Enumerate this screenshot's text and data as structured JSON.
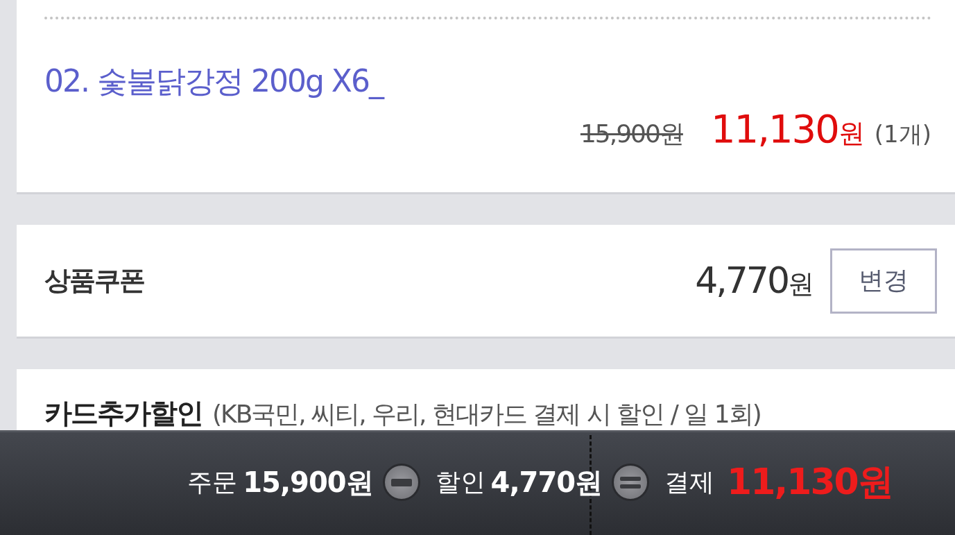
{
  "product": {
    "name": "02. 숯불닭강정 200g X6_",
    "original_price": "15,900원",
    "sale_amount": "11,130",
    "sale_unit": "원",
    "quantity": "(1개)"
  },
  "coupon": {
    "label": "상품쿠폰",
    "amount": "4,770",
    "unit": "원",
    "button": "변경"
  },
  "card_discount": {
    "label": "카드추가할인",
    "note": "(KB국민, 씨티, 우리, 현대카드 결제 시 할인 / 일 1회)"
  },
  "summary_bar": {
    "items": [
      {
        "kind": "amount",
        "label": "주문",
        "value": "15,900원"
      },
      {
        "kind": "minus"
      },
      {
        "kind": "amount",
        "label": "할인",
        "value": "4,770원"
      },
      {
        "kind": "equals"
      },
      {
        "kind": "total",
        "label": "결제",
        "value": "11,130원"
      }
    ]
  }
}
